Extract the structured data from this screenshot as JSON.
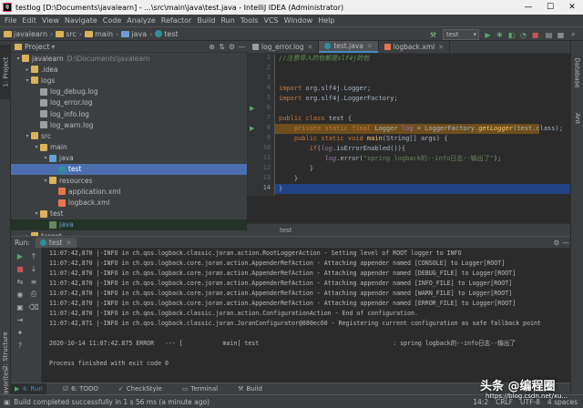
{
  "window": {
    "title": "testlog [D:\\Documents\\javalearn] - ...\\src\\main\\java\\test.java - IntelliJ IDEA (Administrator)",
    "app_icon": "IJ",
    "min": "—",
    "max": "☐",
    "close": "✕"
  },
  "menu": [
    "File",
    "Edit",
    "View",
    "Navigate",
    "Code",
    "Analyze",
    "Refactor",
    "Build",
    "Run",
    "Tools",
    "VCS",
    "Window",
    "Help"
  ],
  "breadcrumbs": [
    "javalearn",
    "src",
    "main",
    "java",
    "test"
  ],
  "toolbar": {
    "run_config": "test",
    "icons": [
      "hammer-icon",
      "play-icon",
      "debug-icon",
      "coverage-icon",
      "profile-icon",
      "stop-icon",
      "sdk-icon",
      "structure-icon",
      "search-icon"
    ]
  },
  "left_strip": {
    "project": "1: Project",
    "structure": "2: Structure",
    "favorites": "2: Favorites"
  },
  "right_strip": {
    "database": "Database",
    "ant": "Ant"
  },
  "project_panel": {
    "title": "Project",
    "rows": [
      {
        "label": "javalearn",
        "path": "D:\\Documents\\javalearn",
        "indent": 0,
        "arrow": "▾",
        "icon": "folder"
      },
      {
        "label": ".idea",
        "indent": 1,
        "arrow": "▸",
        "icon": "folder"
      },
      {
        "label": "logs",
        "indent": 1,
        "arrow": "▾",
        "icon": "folder"
      },
      {
        "label": "log_debug.log",
        "indent": 2,
        "arrow": "",
        "icon": "log"
      },
      {
        "label": "log_error.log",
        "indent": 2,
        "arrow": "",
        "icon": "log"
      },
      {
        "label": "log_info.log",
        "indent": 2,
        "arrow": "",
        "icon": "log"
      },
      {
        "label": "log_warn.log",
        "indent": 2,
        "arrow": "",
        "icon": "log"
      },
      {
        "label": "src",
        "indent": 1,
        "arrow": "▾",
        "icon": "folder"
      },
      {
        "label": "main",
        "indent": 2,
        "arrow": "▾",
        "icon": "folder"
      },
      {
        "label": "java",
        "indent": 3,
        "arrow": "▾",
        "icon": "folder-blue"
      },
      {
        "label": "test",
        "indent": 4,
        "arrow": "",
        "icon": "java",
        "selected": true
      },
      {
        "label": "resources",
        "indent": 3,
        "arrow": "▾",
        "icon": "folder"
      },
      {
        "label": "application.xml",
        "indent": 4,
        "arrow": "",
        "icon": "xml"
      },
      {
        "label": "logback.xml",
        "indent": 4,
        "arrow": "",
        "icon": "xml"
      },
      {
        "label": "test",
        "indent": 2,
        "arrow": "▾",
        "icon": "folder"
      },
      {
        "label": "java",
        "indent": 3,
        "arrow": "",
        "icon": "folder-green",
        "highlight": true
      },
      {
        "label": "target",
        "indent": 1,
        "arrow": "▸",
        "icon": "folder"
      }
    ]
  },
  "editor_tabs": [
    {
      "label": "log_error.log",
      "icon": "log"
    },
    {
      "label": "test.java",
      "icon": "java",
      "active": true
    },
    {
      "label": "logback.xml",
      "icon": "xml"
    }
  ],
  "gutter_lines": [
    "1",
    "2",
    "3",
    "4",
    "5",
    "6",
    "7",
    "8",
    "9",
    "10",
    "11",
    "12",
    "13",
    "14"
  ],
  "code": {
    "l1": "//注意导入的包都是slf4j的包",
    "l3a": "import",
    "l3b": " org.slf4j.Logger;",
    "l4a": "import",
    "l4b": " org.slf4j.LoggerFactory;",
    "l6a": "public class",
    "l6b": " test {",
    "l7a": "    private static final",
    "l7b": " Logger ",
    "l7c": "log",
    "l7d": " = LoggerFactory.",
    "l7e": "getLogger",
    "l7f": "(test.class);",
    "l8a": "    public static void",
    "l8b": " main",
    "l8c": "(String[] args) {",
    "l9a": "        if",
    "l9b": "(",
    "l9c": "log",
    "l9d": ".isErrorEnabled()){",
    "l10a": "            ",
    "l10b": "log",
    "l10c": ".error(",
    "l10d": "\"spring logback的--info日志--输出了\"",
    "l10e": ");",
    "l11": "        }",
    "l12": "    }",
    "l13": "}"
  },
  "editor_footer": "test",
  "run_panel": {
    "label": "Run:",
    "tab": "test",
    "console": [
      "11:07:42,870 |-INFO in ch.qos.logback.classic.joran.action.RootLoggerAction - Setting level of ROOT logger to INFO",
      "11:07:42,870 |-INFO in ch.qos.logback.core.joran.action.AppenderRefAction - Attaching appender named [CONSOLE] to Logger[ROOT]",
      "11:07:42,870 |-INFO in ch.qos.logback.core.joran.action.AppenderRefAction - Attaching appender named [DEBUG_FILE] to Logger[ROOT]",
      "11:07:42,870 |-INFO in ch.qos.logback.core.joran.action.AppenderRefAction - Attaching appender named [INFO_FILE] to Logger[ROOT]",
      "11:07:42,870 |-INFO in ch.qos.logback.core.joran.action.AppenderRefAction - Attaching appender named [WARN_FILE] to Logger[ROOT]",
      "11:07:42,870 |-INFO in ch.qos.logback.core.joran.action.AppenderRefAction - Attaching appender named [ERROR_FILE] to Logger[ROOT]",
      "11:07:42,870 |-INFO in ch.qos.logback.classic.joran.action.ConfigurationAction - End of configuration.",
      "11:07:42,871 |-INFO in ch.qos.logback.classic.joran.JoranConfigurator@880ec60 - Registering current configuration as safe fallback point",
      "",
      "2020-10-14 11:07:42.875 ERROR   --- [           main] test                                     : spring logback的--info日志--输出了",
      "",
      "Process finished with exit code 0"
    ]
  },
  "bottom_tabs": [
    {
      "label": "4: Run",
      "active": true
    },
    {
      "label": "6: TODO"
    },
    {
      "label": "CheckStyle"
    },
    {
      "label": "Terminal"
    },
    {
      "label": "Build"
    }
  ],
  "status": {
    "message": "Build completed successfully in 1 s 56 ms (a minute ago)",
    "position": "14:2",
    "line_sep": "CRLF",
    "encoding": "UTF-8",
    "indent": "4 spaces"
  },
  "watermark": {
    "main": "头条 @编程圈",
    "sub": "https://blog.csdn.net/xu..."
  }
}
